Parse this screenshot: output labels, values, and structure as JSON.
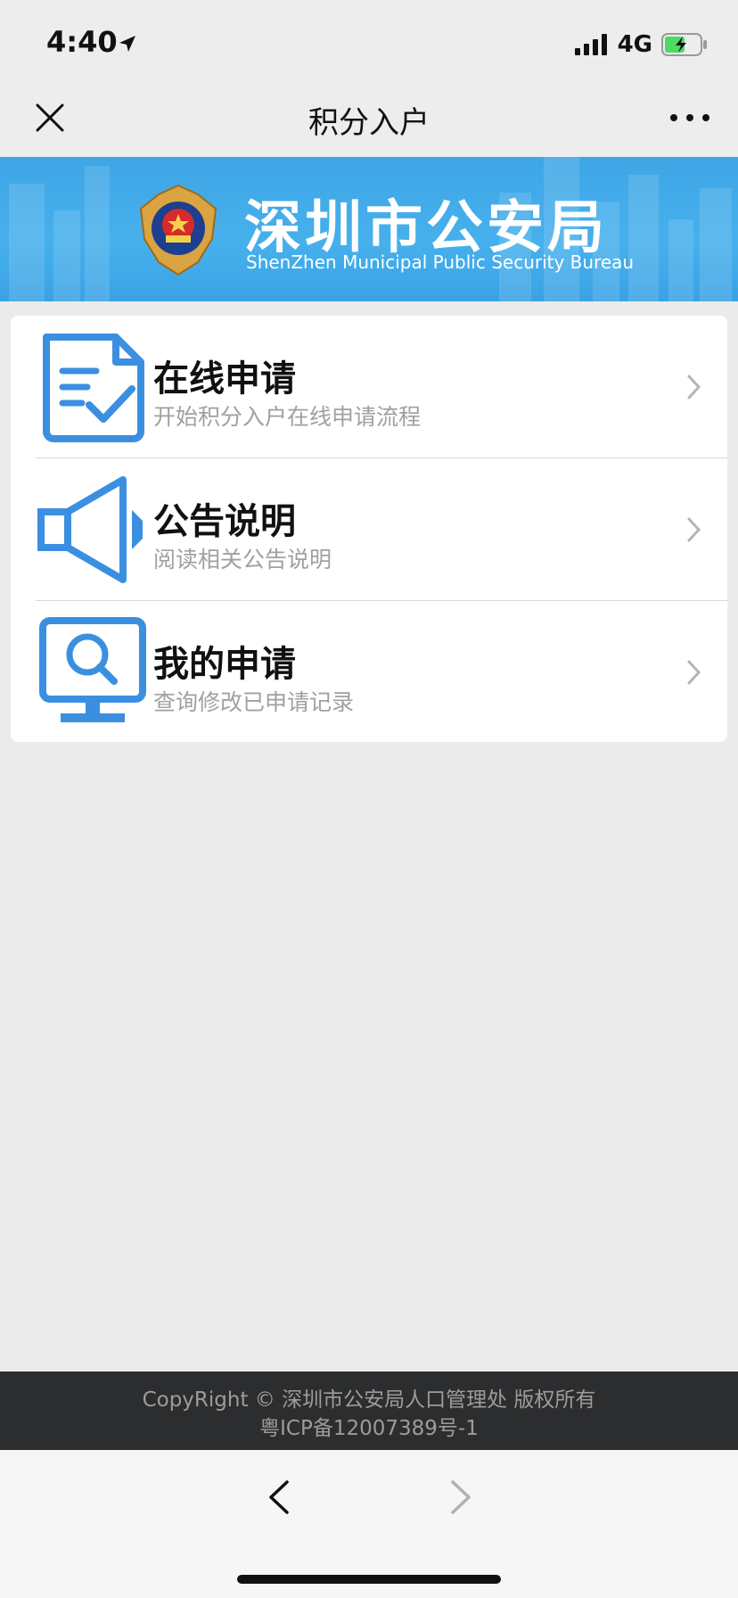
{
  "status_bar": {
    "time": "4:40",
    "network": "4G",
    "icons": [
      "location-arrow-icon",
      "signal-icon",
      "battery-charging-icon"
    ]
  },
  "nav": {
    "title": "积分入户",
    "close_icon": "close-icon",
    "more_icon": "more-icon"
  },
  "banner": {
    "title": "深圳市公安局",
    "subtitle": "ShenZhen Municipal Public Security Bureau",
    "emblem_icon": "police-emblem-icon"
  },
  "menu": {
    "items": [
      {
        "title": "在线申请",
        "desc": "开始积分入户在线申请流程",
        "icon": "document-check-icon"
      },
      {
        "title": "公告说明",
        "desc": "阅读相关公告说明",
        "icon": "speaker-icon"
      },
      {
        "title": "我的申请",
        "desc": "查询修改已申请记录",
        "icon": "monitor-search-icon"
      }
    ]
  },
  "footer": {
    "line1": "CopyRight © 深圳市公安局人口管理处 版权所有",
    "line2": "粤ICP备12007389号-1"
  },
  "colors": {
    "accent": "#3b8fe0",
    "banner": "#46b0ec",
    "footer_bg": "#2c2d2f",
    "page_bg": "#ebebeb"
  }
}
